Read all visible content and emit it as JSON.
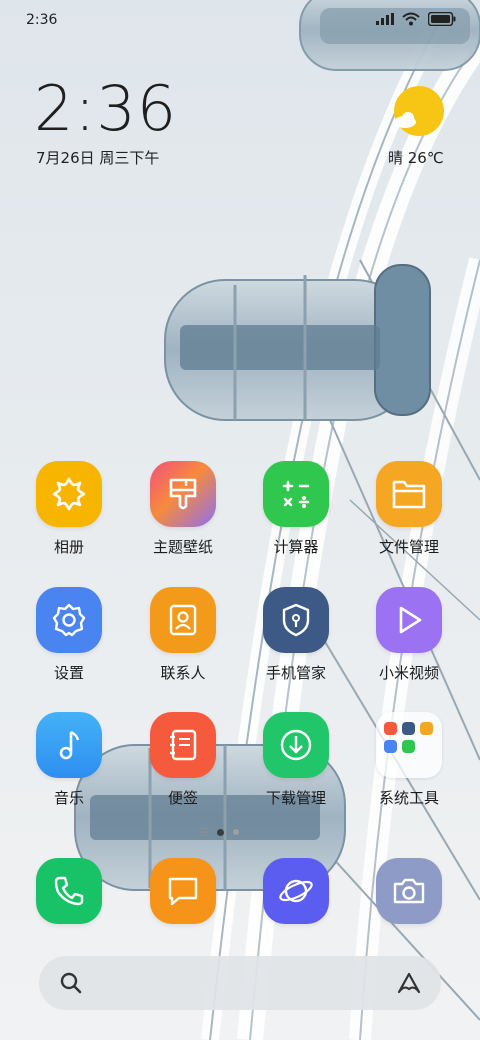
{
  "status_bar": {
    "time": "2:36"
  },
  "clock_widget": {
    "time": "2:36",
    "date": "7月26日 周三下午"
  },
  "weather_widget": {
    "text": "晴 26℃",
    "icon": "sunny-cloud-icon"
  },
  "apps": [
    {
      "label": "相册",
      "icon": "gallery-icon",
      "color": "#f7b500"
    },
    {
      "label": "主题壁纸",
      "icon": "theme-brush-icon",
      "color": "#e94c8c"
    },
    {
      "label": "计算器",
      "icon": "calculator-icon",
      "color": "#2fc74d"
    },
    {
      "label": "文件管理",
      "icon": "folder-icon",
      "color": "#f5a623"
    },
    {
      "label": "设置",
      "icon": "settings-gear-icon",
      "color": "#4a84f0"
    },
    {
      "label": "联系人",
      "icon": "contacts-icon",
      "color": "#f49a1a"
    },
    {
      "label": "手机管家",
      "icon": "security-shield-icon",
      "color": "#3d5a86"
    },
    {
      "label": "小米视频",
      "icon": "video-play-icon",
      "color": "#9a72f2"
    },
    {
      "label": "音乐",
      "icon": "music-note-icon",
      "color": "#3ca3f5"
    },
    {
      "label": "便签",
      "icon": "notes-icon",
      "color": "#f55a3c"
    },
    {
      "label": "下载管理",
      "icon": "download-icon",
      "color": "#22c66a"
    },
    {
      "label": "系统工具",
      "icon": "folder-system-tools-icon",
      "color": "#ffffff"
    }
  ],
  "dock": [
    {
      "name": "phone",
      "icon": "phone-icon",
      "color": "#18c266"
    },
    {
      "name": "messages",
      "icon": "message-icon",
      "color": "#f59418"
    },
    {
      "name": "browser",
      "icon": "browser-planet-icon",
      "color": "#5b5cf0"
    },
    {
      "name": "camera",
      "icon": "camera-icon",
      "color": "#8d9bc6"
    }
  ],
  "search_bar": {
    "left_icon": "search-icon",
    "right_icon": "assistant-icon"
  }
}
